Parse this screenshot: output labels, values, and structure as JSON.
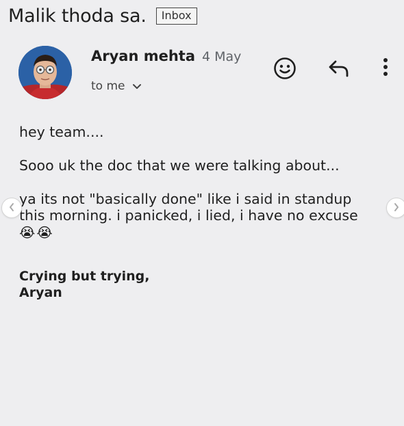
{
  "email": {
    "subject": "Malik thoda sa.",
    "label": "Inbox",
    "sender": "Aryan mehta",
    "date": "4 May",
    "recipient": "to me",
    "body": {
      "greeting": "hey team....",
      "line1": "Sooo uk the doc that we were talking about...",
      "line2a": "ya its not \"basically done\" like i said in standup",
      "line2b": "this morning. i panicked, i lied, i have no excuse",
      "emojis": "😭😭"
    },
    "signature": {
      "line1": "Crying but trying,",
      "line2": "Aryan"
    }
  },
  "icons": {
    "emoji_reaction": "smiley-icon",
    "reply": "reply-icon",
    "more": "more-vert-icon",
    "expand": "chevron-down-icon",
    "prev": "chevron-left-icon",
    "next": "chevron-right-icon"
  },
  "colors": {
    "background": "#eeeef0",
    "text": "#1f1f1f",
    "secondary_text": "#5f6368"
  }
}
